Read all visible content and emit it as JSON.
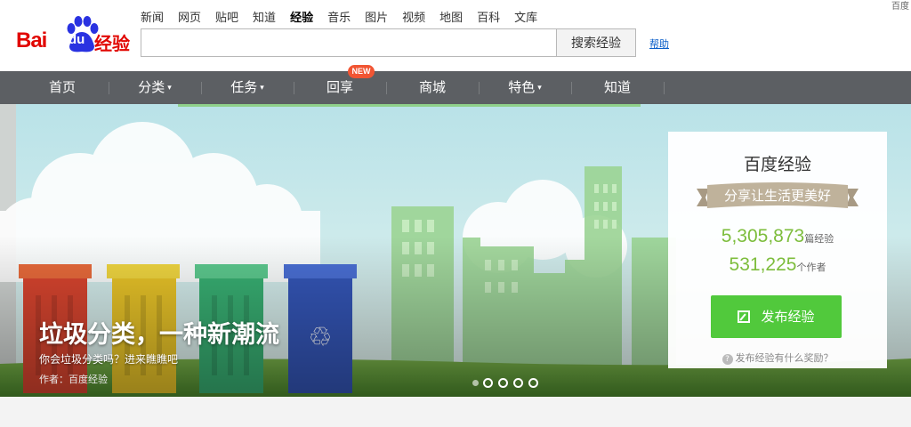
{
  "logo": {
    "bai": "Bai",
    "du": "du",
    "jingyan": "经验"
  },
  "corner_text": "百度",
  "top_nav": [
    "新闻",
    "网页",
    "贴吧",
    "知道",
    "经验",
    "音乐",
    "图片",
    "视频",
    "地图",
    "百科",
    "文库"
  ],
  "top_nav_active": "经验",
  "search": {
    "value": "",
    "placeholder": "",
    "button": "搜索经验",
    "help": "帮助"
  },
  "main_nav": [
    {
      "label": "首页",
      "dropdown": false
    },
    {
      "label": "分类",
      "dropdown": true
    },
    {
      "label": "任务",
      "dropdown": true
    },
    {
      "label": "回享",
      "dropdown": false
    },
    {
      "label": "商城",
      "dropdown": false
    },
    {
      "label": "特色",
      "dropdown": true
    },
    {
      "label": "知道",
      "dropdown": false
    }
  ],
  "new_badge": "NEW",
  "banner": {
    "title": "垃圾分类，一种新潮流",
    "subtitle": "你会垃圾分类吗？进来瞧瞧吧",
    "author": "作者：百度经验",
    "slide_count": 5,
    "active_slide": 0
  },
  "card": {
    "title": "百度经验",
    "slogan": "分享让生活更美好",
    "articles_count": "5,305,873",
    "articles_unit": "篇经验",
    "authors_count": "531,225",
    "authors_unit": "个作者",
    "publish_button": "发布经验",
    "reward_link": "发布经验有什么奖励？"
  },
  "colors": {
    "brand_red": "#e10601",
    "brand_blue": "#2932e1",
    "nav_bg": "#5c5f63",
    "accent_green": "#51c93c",
    "count_green": "#7dbd3c",
    "badge_red": "#f15533"
  }
}
